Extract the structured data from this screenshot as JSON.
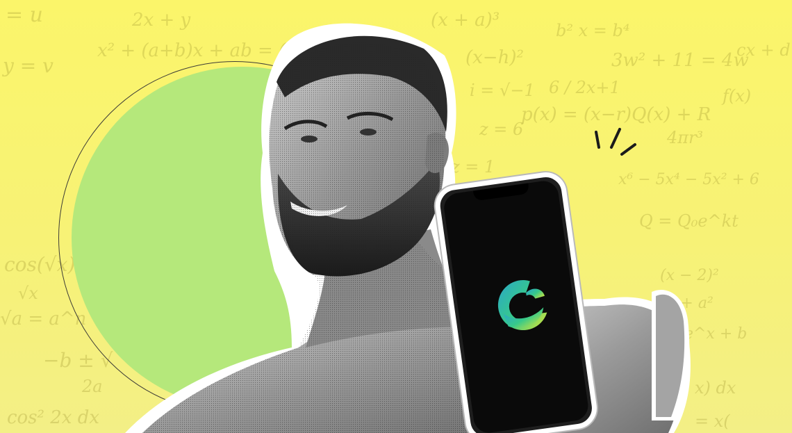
{
  "formulas": [
    "= u",
    "x² + (a+b)x + ab = (x",
    "y = v",
    "(x−h)²",
    "3w² + 11 = 4w",
    "6 / 2x+1",
    "i = √−1",
    "cx + d",
    "p(x) = (x−r)Q(x) + R",
    "4πr³",
    "x⁶ − 5x⁴ − 5x² + 6",
    "Q = Q₀e^kt",
    "x + a²",
    "e^x + b",
    "(x − 2)²",
    "cos(√x)",
    "√x",
    "√a = a^n",
    "−b ± √",
    "2a",
    "cos² 2x dx",
    "x) dx",
    "= x(",
    "+ 5z = 1",
    "z = 6",
    "f(x)",
    "b² x = b⁴",
    "(x + a)³",
    "2x + y"
  ],
  "palette": {
    "background_top": "#fbf56a",
    "background_bottom": "#f3ef86",
    "green_circle": "#b5e87b",
    "ring_stroke": "#3c3b36",
    "phone_screen": "#0a0a0a"
  },
  "icons": {
    "app_logo": "app-logo-icon",
    "sparkle": "sparkle-lines-icon"
  }
}
